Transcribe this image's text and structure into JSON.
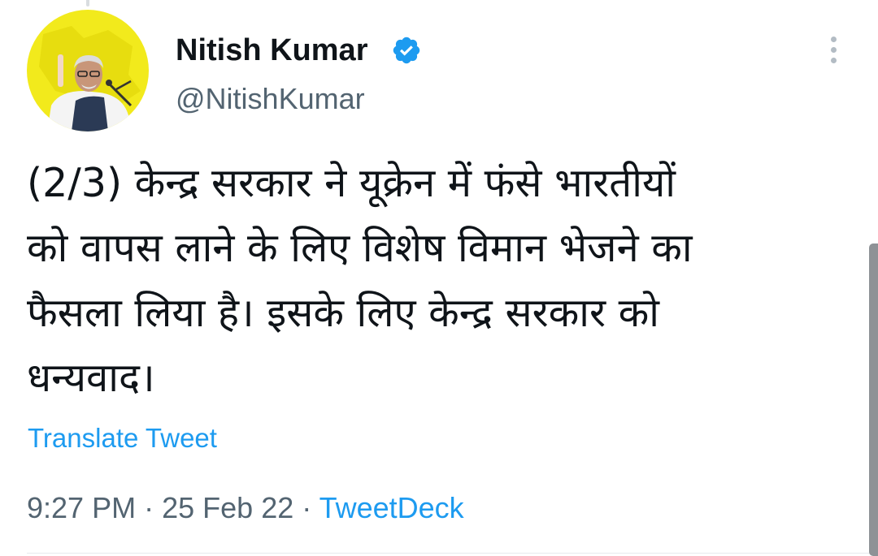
{
  "tweet": {
    "author": {
      "display_name": "Nitish Kumar",
      "handle": "@NitishKumar",
      "verified": true,
      "avatar_bg_color": "#f2ea1c"
    },
    "text": "(2/3) केन्द्र सरकार ने यूक्रेन में फंसे भारतीयों\nको वापस लाने के लिए विशेष विमान भेजने का\nफैसला लिया है। इसके लिए केन्द्र सरकार को\nधन्यवाद।",
    "translate_label": "Translate Tweet",
    "time": "9:27 PM",
    "date": "25 Feb 22",
    "separator": "·",
    "source": "TweetDeck"
  },
  "icons": {
    "verified": "verified-badge-icon",
    "more": "more-options-icon"
  },
  "colors": {
    "link": "#1d9bf0",
    "secondary_text": "#536471",
    "primary_text": "#0f1419",
    "verified_badge": "#1d9bf0"
  }
}
